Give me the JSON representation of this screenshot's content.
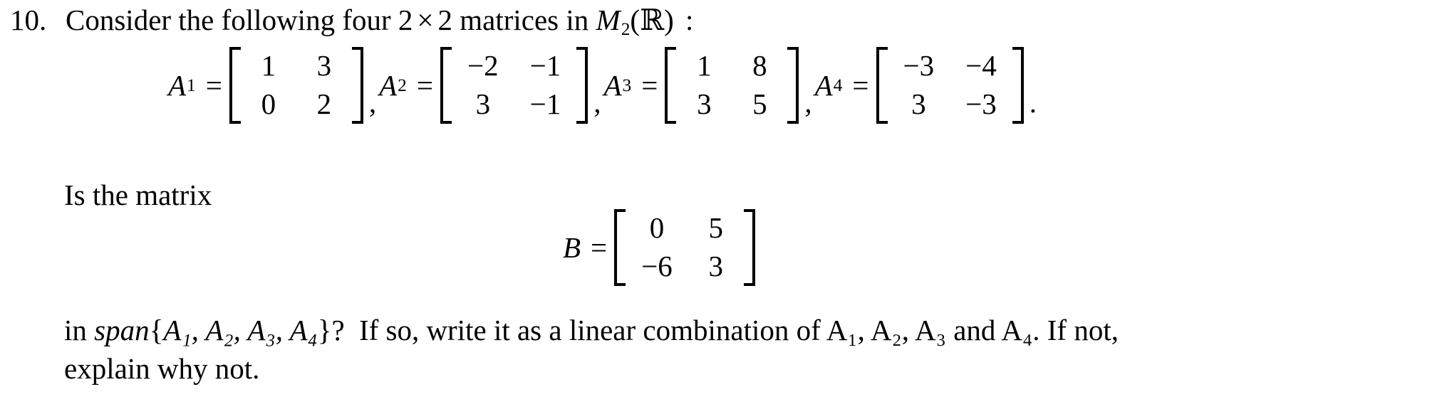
{
  "document": {
    "type": "math-exercise",
    "text_color": "#000000",
    "background_color": "#ffffff"
  },
  "problem": {
    "number": "10.",
    "stem": {
      "before_dim": "Consider the following four",
      "dim_a": "2",
      "times": "×",
      "dim_b": "2",
      "after_dim": "matrices in",
      "space_name": "M",
      "space_sub": "2",
      "space_open": "(",
      "space_field": "ℝ",
      "space_close": ")",
      "colon": ":"
    },
    "matrices": [
      {
        "name": "A",
        "subscript": "1",
        "equals": "=",
        "rows": [
          [
            "1",
            "3"
          ],
          [
            "0",
            "2"
          ]
        ],
        "separator": ","
      },
      {
        "name": "A",
        "subscript": "2",
        "equals": "=",
        "rows": [
          [
            "−2",
            "−1"
          ],
          [
            "3",
            "−1"
          ]
        ],
        "separator": ","
      },
      {
        "name": "A",
        "subscript": "3",
        "equals": "=",
        "rows": [
          [
            "1",
            "8"
          ],
          [
            "3",
            "5"
          ]
        ],
        "separator": ","
      },
      {
        "name": "A",
        "subscript": "4",
        "equals": "=",
        "rows": [
          [
            "−3",
            "−4"
          ],
          [
            "3",
            "−3"
          ]
        ],
        "separator": "."
      }
    ],
    "question_intro": "Is the matrix",
    "target_matrix": {
      "name": "B",
      "equals": "=",
      "rows": [
        [
          "0",
          "5"
        ],
        [
          "−6",
          "3"
        ]
      ]
    },
    "closing": {
      "in_word": "in",
      "span_word": "span",
      "set_open": "{",
      "set_items": "A₁, A₂, A₃, A₄",
      "set_close": "}",
      "question_mark": "?",
      "line1_tail": "If so, write it as a linear combination of A₁, A₂, A₃ and A₄. If not,",
      "line2": "explain why not."
    }
  }
}
